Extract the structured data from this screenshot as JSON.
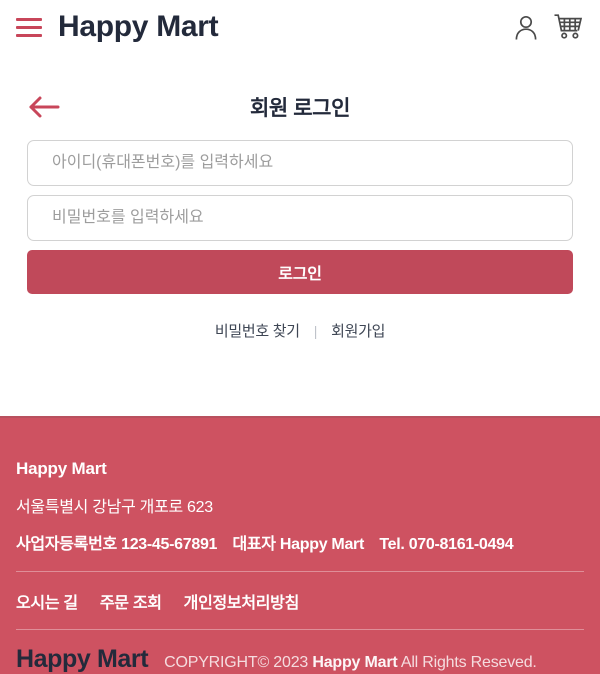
{
  "header": {
    "brand": "Happy Mart",
    "menu_icon": "hamburger-icon",
    "account_icon": "user-icon",
    "cart_icon": "shopping-cart-icon",
    "brand_color": "#232A3B",
    "accent_color": "#C8465A"
  },
  "main": {
    "back_icon": "arrow-left-icon",
    "title": "회원 로그인",
    "id_placeholder": "아이디(휴대폰번호)를 입력하세요",
    "id_value": "",
    "password_placeholder": "비밀번호를 입력하세요",
    "password_value": "",
    "login_label": "로그인",
    "login_button_color": "#C0495A",
    "find_password_label": "비밀번호 찾기",
    "separator": "|",
    "signup_label": "회원가입"
  },
  "footer": {
    "background_color": "#CE5261",
    "brand": "Happy Mart",
    "address": "서울특별시 강남구 개포로 623",
    "biz_label": "사업자등록번호",
    "biz_number": "123-45-67891",
    "ceo_label": "대표자",
    "ceo_name": "Happy Mart",
    "tel_label": "Tel.",
    "tel_number": "070-8161-0494",
    "links": [
      {
        "label": "오시는 길"
      },
      {
        "label": "주문 조회"
      },
      {
        "label": "개인정보처리방침"
      }
    ],
    "logo": "Happy Mart",
    "copyright_prefix": "COPYRIGHT© 2023 ",
    "copyright_brand": "Happy Mart",
    "copyright_suffix": " All Rights Reseved."
  }
}
